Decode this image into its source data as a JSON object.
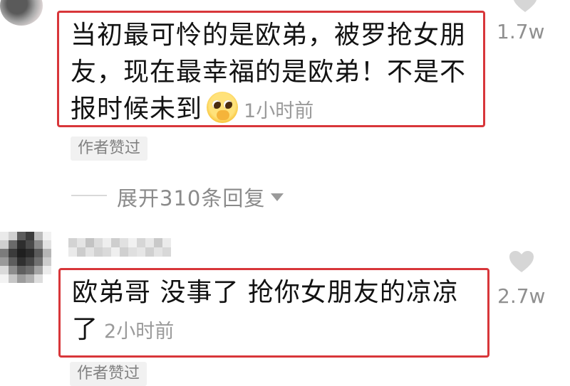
{
  "comments": [
    {
      "text": "当初最可怜的是欧弟，被罗抢女朋友，现在最幸福的是欧弟！不是不报时候未到",
      "emoji_icon": "pleading-face-emoji",
      "time": "1小时前",
      "likes": "1.7w",
      "author_liked_badge": "作者赞过"
    },
    {
      "text": "欧弟哥 没事了 抢你女朋友的凉凉了",
      "time": "2小时前",
      "likes": "2.7w",
      "author_liked_badge": "作者赞过"
    }
  ],
  "expand_replies": {
    "label": "展开310条回复",
    "icon": "caret-down-icon"
  },
  "colors": {
    "highlight_border": "#d8363a",
    "text": "#121212",
    "meta_text": "#9a9a9a",
    "badge_bg": "#f1f1f1"
  }
}
